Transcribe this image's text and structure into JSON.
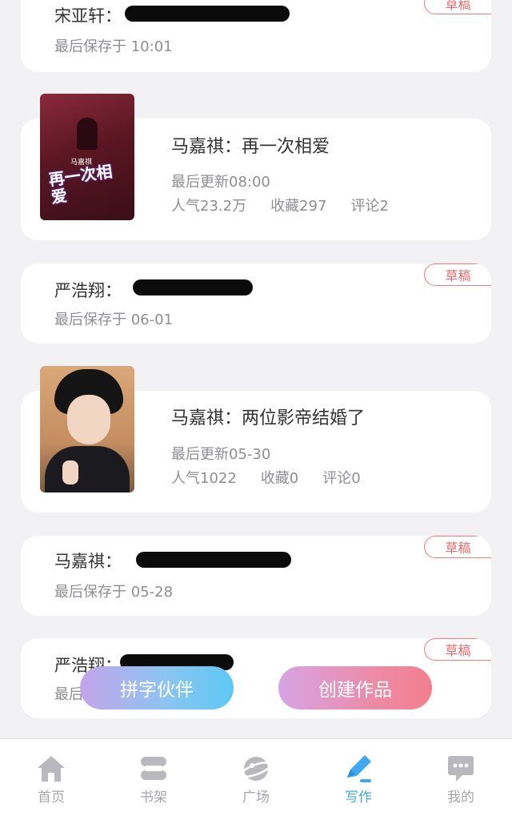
{
  "drafts": [
    {
      "title": "宋亚轩：",
      "meta": "最后保存于 10:01",
      "badge": "草稿"
    },
    {
      "title": "严浩翔：",
      "meta": "最后保存于 06-01",
      "badge": "草稿"
    },
    {
      "title": "马嘉祺：",
      "meta": "最后保存于 05-28",
      "badge": "草稿"
    },
    {
      "title": "严浩翔：",
      "meta": "最后",
      "badge": "草稿"
    }
  ],
  "works": [
    {
      "title": "马嘉祺：再一次相爱",
      "updated": "最后更新08:00",
      "popularity": "人气23.2万",
      "favorites": "收藏297",
      "comments": "评论2",
      "cover_text": "再一次相爱",
      "cover_small": "马嘉祺"
    },
    {
      "title": "马嘉祺：两位影帝结婚了",
      "updated": "最后更新05-30",
      "popularity": "人气1022",
      "favorites": "收藏0",
      "comments": "评论0"
    }
  ],
  "fab": {
    "partner": "拼字伙伴",
    "create": "创建作品"
  },
  "tabs": [
    {
      "label": "首页",
      "icon": "home-icon"
    },
    {
      "label": "书架",
      "icon": "bookshelf-icon"
    },
    {
      "label": "广场",
      "icon": "planet-icon"
    },
    {
      "label": "写作",
      "icon": "pen-icon",
      "active": true
    },
    {
      "label": "我的",
      "icon": "chat-bubble-icon"
    }
  ],
  "colors": {
    "accent": "#3fa8f2",
    "badge": "#ec6a6a",
    "background": "#f2f2f4"
  }
}
